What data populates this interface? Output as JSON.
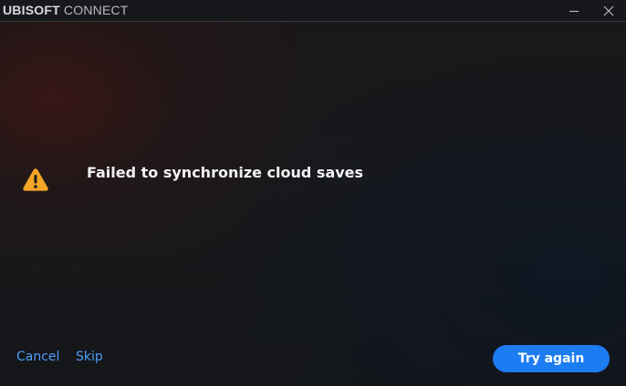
{
  "titlebar": {
    "brand": "UBISOFT",
    "product": " CONNECT",
    "minimize_icon": "minimize-icon",
    "close_icon": "close-icon"
  },
  "dialog": {
    "icon": "warning-icon",
    "message": "Failed to synchronize cloud saves",
    "cancel_label": "Cancel",
    "skip_label": "Skip",
    "try_again_label": "Try again"
  },
  "colors": {
    "warning": "#f5a524",
    "link": "#4d9df5",
    "primary_button": "#1c7cf2"
  }
}
